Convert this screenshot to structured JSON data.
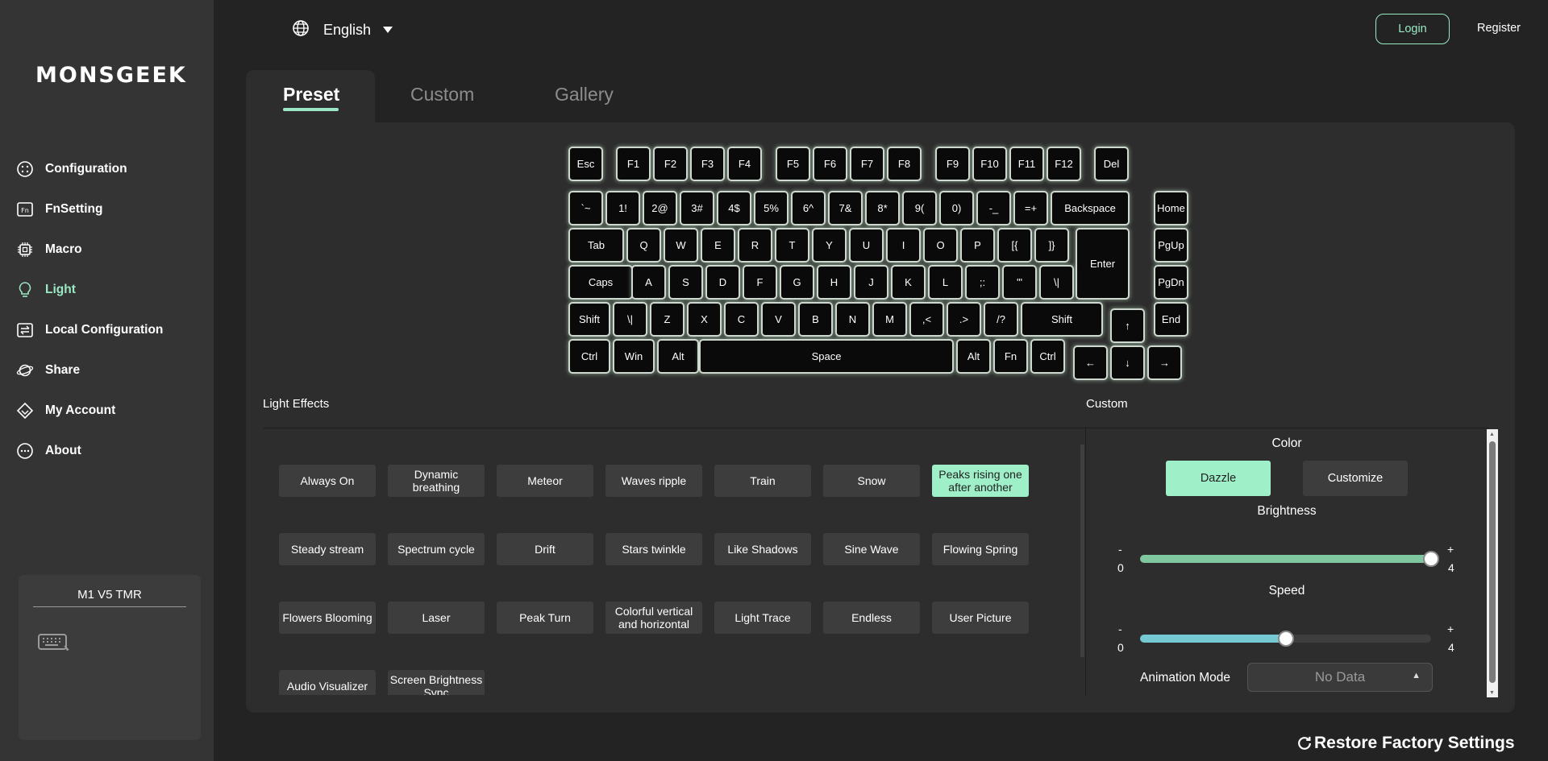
{
  "sidebar": {
    "logo": "MONSGEEK",
    "items": [
      {
        "label": "Configuration",
        "icon": "grid-circle-icon",
        "active": false
      },
      {
        "label": "FnSetting",
        "icon": "fn-icon",
        "active": false
      },
      {
        "label": "Macro",
        "icon": "chip-icon",
        "active": false
      },
      {
        "label": "Light",
        "icon": "bulb-icon",
        "active": true
      },
      {
        "label": "Local Configuration",
        "icon": "local-config-icon",
        "active": false
      },
      {
        "label": "Share",
        "icon": "share-planet-icon",
        "active": false
      },
      {
        "label": "My Account",
        "icon": "account-diamond-icon",
        "active": false
      },
      {
        "label": "About",
        "icon": "more-circle-icon",
        "active": false
      }
    ],
    "device": {
      "name": "M1 V5 TMR",
      "icon": "keyboard-icon"
    }
  },
  "header": {
    "language": "English",
    "login": "Login",
    "register": "Register"
  },
  "tabs": [
    "Preset",
    "Custom",
    "Gallery"
  ],
  "active_tab": "Preset",
  "keyboard": {
    "rows": [
      [
        "Esc",
        "F1",
        "F2",
        "F3",
        "F4",
        "F5",
        "F6",
        "F7",
        "F8",
        "F9",
        "F10",
        "F11",
        "F12",
        "Del"
      ],
      [
        "`~",
        "1!",
        "2@",
        "3#",
        "4$",
        "5%",
        "6^",
        "7&",
        "8*",
        "9(",
        "0)",
        "-_",
        "=+",
        "Backspace",
        "Home"
      ],
      [
        "Tab",
        "Q",
        "W",
        "E",
        "R",
        "T",
        "Y",
        "U",
        "I",
        "O",
        "P",
        "[{",
        "]}",
        "Enter",
        "PgUp"
      ],
      [
        "Caps",
        "A",
        "S",
        "D",
        "F",
        "G",
        "H",
        "J",
        "K",
        "L",
        ";:",
        "'\"",
        "\\|",
        "PgDn"
      ],
      [
        "Shift",
        "\\|",
        "Z",
        "X",
        "C",
        "V",
        "B",
        "N",
        "M",
        ",<",
        ".>",
        "/?",
        "Shift",
        "↑",
        "End"
      ],
      [
        "Ctrl",
        "Win",
        "Alt",
        "Space",
        "Alt",
        "Fn",
        "Ctrl",
        "←",
        "↓",
        "→"
      ]
    ]
  },
  "light_effects": {
    "title": "Light Effects",
    "active": "Peaks rising one after another",
    "items": [
      "Always On",
      "Dynamic breathing",
      "Meteor",
      "Waves ripple",
      "Train",
      "Snow",
      "Peaks rising one after another",
      "Steady stream",
      "Spectrum cycle",
      "Drift",
      "Stars twinkle",
      "Like Shadows",
      "Sine Wave",
      "Flowing Spring",
      "Flowers Blooming",
      "Laser",
      "Peak Turn",
      "Colorful vertical and horizontal",
      "Light Trace",
      "Endless",
      "User Picture",
      "Audio Visualizer",
      "Screen Brightness Sync"
    ]
  },
  "custom": {
    "title": "Custom",
    "color_label": "Color",
    "dazzle": "Dazzle",
    "customize": "Customize",
    "brightness_label": "Brightness",
    "brightness": {
      "min_symbol": "-",
      "max_symbol": "+",
      "min": "0",
      "max": "4",
      "value": 4
    },
    "speed_label": "Speed",
    "speed": {
      "min_symbol": "-",
      "max_symbol": "+",
      "min": "0",
      "max": "4",
      "value": 2
    },
    "animation_mode_label": "Animation Mode",
    "animation_mode_value": "No Data"
  },
  "colors": {
    "accent": "#9be8c5",
    "brightness_fill": "#7fc79e",
    "speed_fill": "#74c9d2"
  },
  "restore": "Restore Factory Settings"
}
